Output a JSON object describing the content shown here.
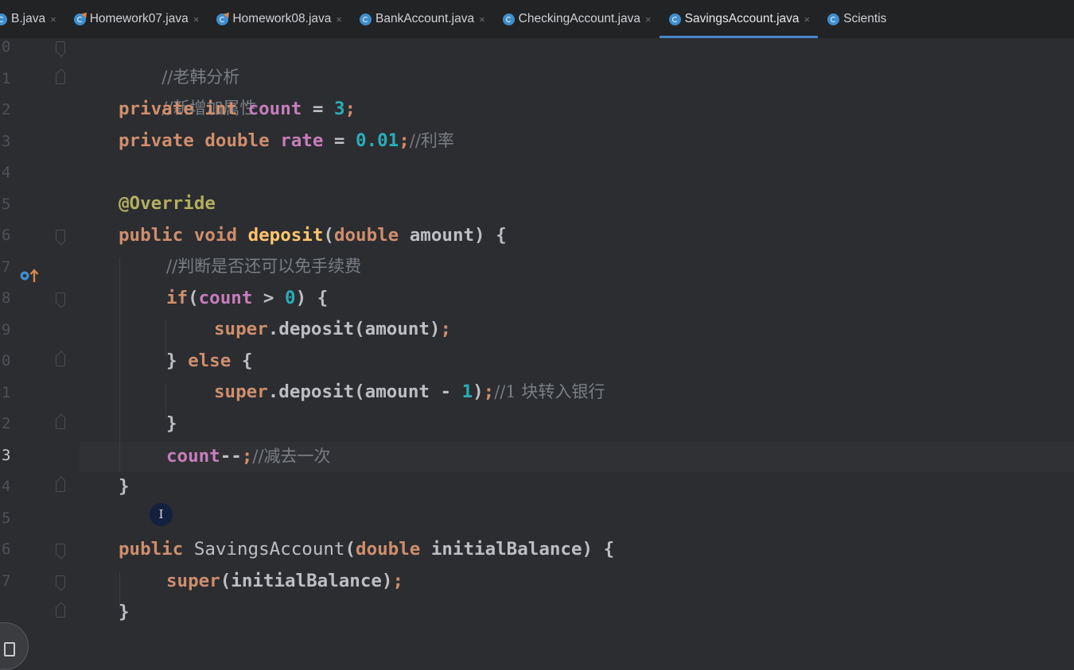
{
  "tabs": [
    {
      "label": "B.java",
      "icon": "class-icon",
      "active": false
    },
    {
      "label": "Homework07.java",
      "icon": "class-icon-with-override",
      "active": false
    },
    {
      "label": "Homework08.java",
      "icon": "class-icon-with-override",
      "active": false
    },
    {
      "label": "BankAccount.java",
      "icon": "class-icon",
      "active": false
    },
    {
      "label": "CheckingAccount.java",
      "icon": "class-icon",
      "active": false
    },
    {
      "label": "SavingsAccount.java",
      "icon": "class-icon",
      "active": true
    },
    {
      "label": "Scientis",
      "icon": "class-icon",
      "active": false
    }
  ],
  "tab_close_glyph": "×",
  "gutter": {
    "line_numbers": [
      "0",
      "1",
      "2",
      "3",
      "4",
      "5",
      "6",
      "7",
      "8",
      "9",
      "0",
      "1",
      "2",
      "3",
      "4",
      "5",
      "6",
      "7"
    ],
    "current_line_index": 13
  },
  "code": {
    "l0_comment": "//老韩分析",
    "l1_comment": "//新增加属性",
    "l2_private": "private",
    "l2_int": "int",
    "l2_field": "count",
    "l2_eq": " = ",
    "l2_num": "3",
    "l2_semi": ";",
    "l3_private": "private",
    "l3_double": "double",
    "l3_field": "rate",
    "l3_eq": " = ",
    "l3_num": "0.01",
    "l3_semi": ";",
    "l3_comment": "//利率",
    "l5_annotation": "@Override",
    "l6_public": "public",
    "l6_void": "void",
    "l6_method": "deposit",
    "l6_open": "(",
    "l6_double": "double",
    "l6_param": "amount) {",
    "l7_comment": "//判断是否还可以免手续费",
    "l8_if": "if",
    "l8_open": "(",
    "l8_field": "count",
    "l8_gt": " > ",
    "l8_num": "0",
    "l8_close": ") {",
    "l9_super": "super",
    "l9_call": ".deposit(amount)",
    "l9_semi": ";",
    "l10_brace": "} ",
    "l10_else": "else",
    "l10_open": " {",
    "l11_super": "super",
    "l11_call": ".deposit(amount - ",
    "l11_num": "1",
    "l11_close": ")",
    "l11_semi": ";",
    "l11_comment": "//1 块转入银行",
    "l12_brace": "}",
    "l13_field": "count",
    "l13_dec": "--",
    "l13_semi": ";",
    "l13_comment": "//减去一次",
    "l14_brace": "}",
    "l16_public": "public",
    "l16_ctor": "SavingsAccount",
    "l16_open": "(",
    "l16_double": "double",
    "l16_param": "initialBalance) {",
    "l17_super": "super",
    "l17_args": "(initialBalance)",
    "l17_semi": ";",
    "l18_brace": "}"
  },
  "cursor_badge": "I",
  "colors": {
    "background": "#2b2d30",
    "keyword": "#cf8e6d",
    "field": "#c77dbb",
    "number": "#2aacb8",
    "annotation": "#b3ae60",
    "method": "#56a8f5",
    "comment": "#7a7e85",
    "active_tab_underline": "#4a86c7"
  }
}
